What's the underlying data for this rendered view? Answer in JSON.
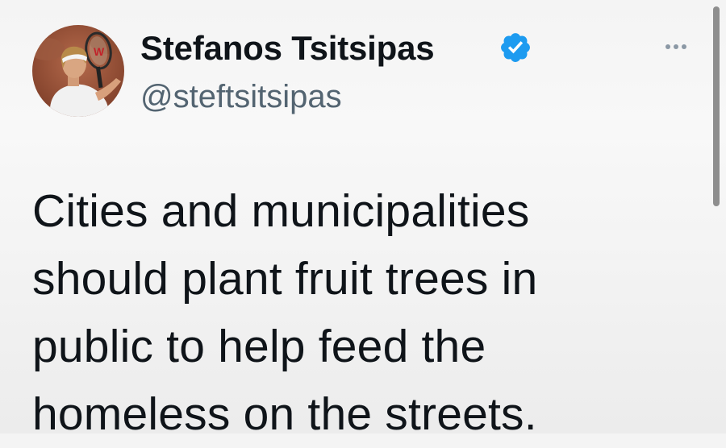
{
  "author": {
    "display_name": "Stefanos Tsitsipas",
    "handle": "@steftsitsipas",
    "verified": true
  },
  "tweet": {
    "lines": [
      "Cities and municipalities",
      "should plant fruit trees in",
      "public to help feed the",
      "homeless on the streets."
    ]
  },
  "icons": {
    "verified": "verified-badge-icon",
    "more": "more-options-icon",
    "avatar": "profile-photo"
  },
  "colors": {
    "text_primary": "#0f1419",
    "text_secondary": "#536471",
    "verified_blue": "#1d9bf0"
  }
}
